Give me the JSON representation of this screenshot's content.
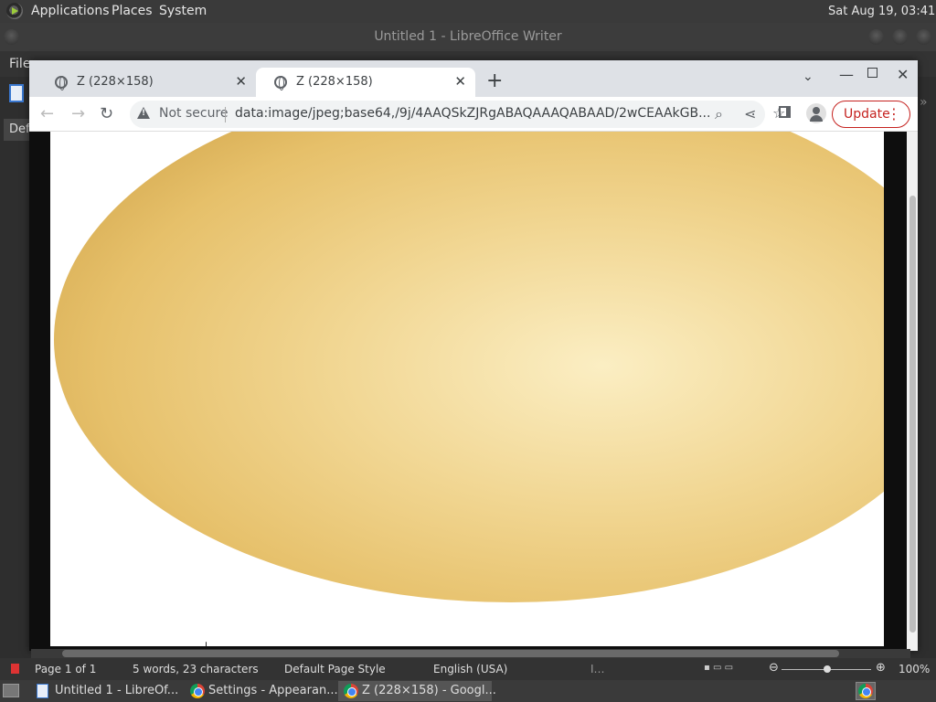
{
  "top_panel": {
    "menus": [
      "Applications",
      "Places",
      "System"
    ],
    "clock": "Sat Aug 19, 03:41"
  },
  "libreoffice": {
    "window_title": "Untitled 1 - LibreOffice Writer",
    "menu_file": "File",
    "style_box_text": "Def",
    "statusbar": {
      "page": "Page 1 of 1",
      "words": "5 words, 23 characters",
      "page_style": "Default Page Style",
      "language": "English (USA)",
      "zoom": "100%"
    }
  },
  "chrome": {
    "tabs": [
      {
        "title": "Z (228×158)"
      },
      {
        "title": "Z (228×158)"
      }
    ],
    "omnibox": {
      "security_label": "Not secure",
      "url": "data:image/jpeg;base64,/9j/4AAQSkZJRgABAQAAAQABAAD/2wCEAAkGB..."
    },
    "update_label": "Update"
  },
  "taskbar": {
    "items": [
      {
        "label": "Untitled 1 - LibreOf..."
      },
      {
        "label": "Settings - Appearan..."
      },
      {
        "label": "Z (228×158) - Googl..."
      }
    ]
  },
  "colors": {
    "accent_update": "#c5221f",
    "panel_bg": "#3a3a3a"
  }
}
